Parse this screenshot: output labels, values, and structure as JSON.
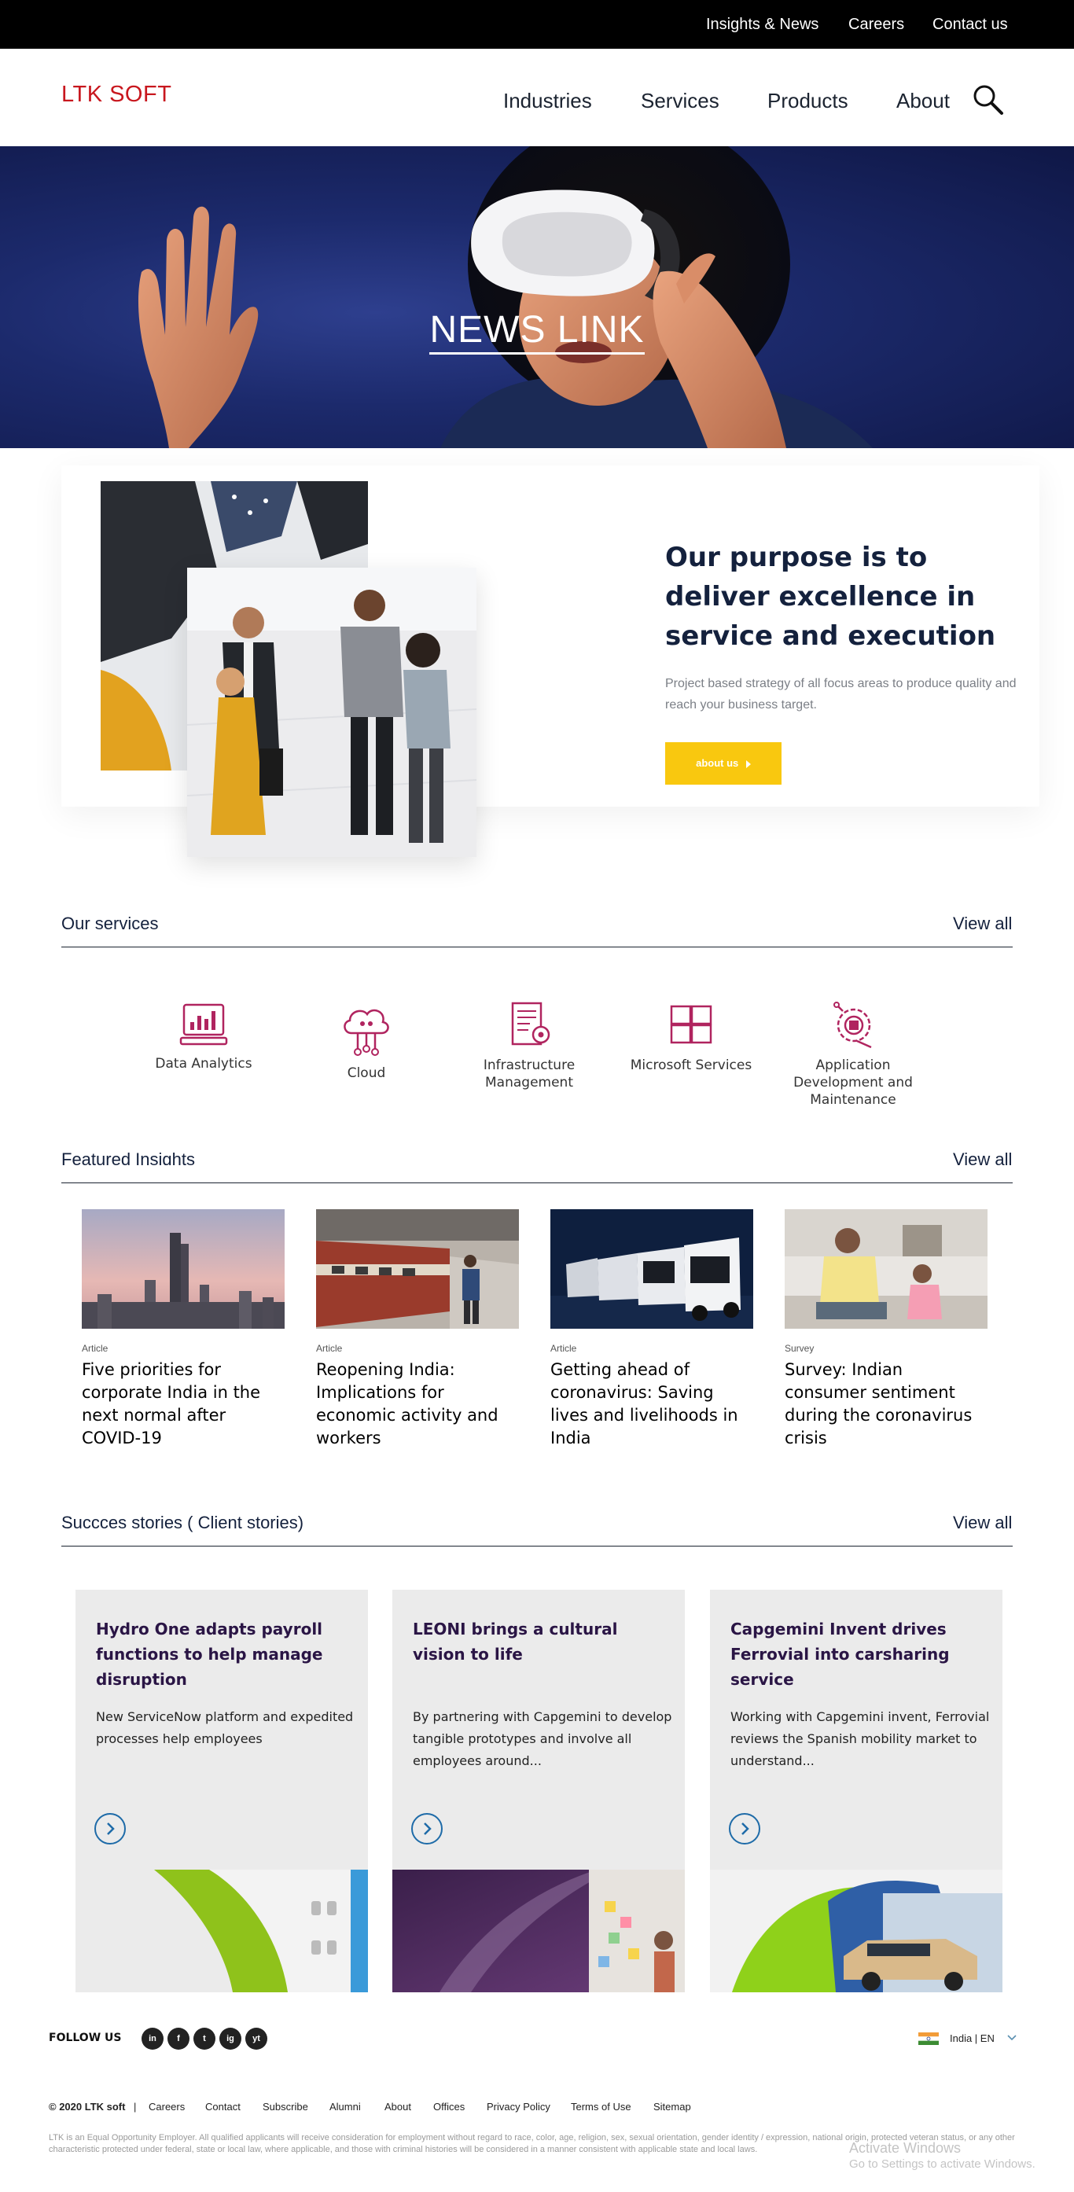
{
  "topbar": {
    "links": [
      "Insights & News",
      "Careers",
      "Contact us"
    ]
  },
  "header": {
    "logo": "LTK SOFT",
    "nav": [
      "Industries",
      "Services",
      "Products",
      "About"
    ]
  },
  "hero": {
    "title": "NEWS LINK"
  },
  "purpose": {
    "heading": "Our purpose is to deliver excellence in service and execution",
    "text": "Project based strategy of all focus areas to produce quality and reach your business target.",
    "button": "about us"
  },
  "services": {
    "title": "Our services",
    "view_all": "View all",
    "items": [
      {
        "label": "Data Analytics",
        "icon": "data-analytics-icon"
      },
      {
        "label": "Cloud",
        "icon": "cloud-icon"
      },
      {
        "label": "Infrastructure Management",
        "icon": "infrastructure-icon"
      },
      {
        "label": "Microsoft Services",
        "icon": "microsoft-icon"
      },
      {
        "label": "Application Development and Maintenance",
        "icon": "app-development-icon"
      }
    ],
    "icon_color": "#b0245f"
  },
  "insights": {
    "title": "Featured Insights",
    "view_all": "View all",
    "items": [
      {
        "type": "Article",
        "title": "Five priorities for corporate India in the next normal after COVID-19"
      },
      {
        "type": "Article",
        "title": "Reopening India: Implications for economic activity and workers"
      },
      {
        "type": "Article",
        "title": "Getting ahead of coronavirus: Saving lives and livelihoods in India"
      },
      {
        "type": "Survey",
        "title": "Survey: Indian consumer sentiment during the coronavirus crisis"
      }
    ]
  },
  "stories": {
    "title": "Succces stories ( Client stories)",
    "view_all": "View all",
    "items": [
      {
        "title": "Hydro One adapts payroll functions to help manage disruption",
        "text": "New ServiceNow platform and expedited processes help employees"
      },
      {
        "title": "LEONI brings a cultural vision to life",
        "text": "By partnering with Capgemini to develop tangible prototypes and involve all employees around..."
      },
      {
        "title": "Capgemini Invent drives Ferrovial into carsharing service",
        "text": "Working with Capgemini invent, Ferrovial reviews the Spanish mobility market to understand..."
      }
    ]
  },
  "footer": {
    "follow": "FOLLOW US",
    "social": [
      "in",
      "f",
      "t",
      "ig",
      "yt"
    ],
    "locale": "India | EN",
    "copyright": "© 2020 LTK soft",
    "separator": "|",
    "links": [
      "Careers",
      "Contact",
      "Subscribe",
      "Alumni",
      "About",
      "Offices",
      "Privacy Policy",
      "Terms of Use",
      "Sitemap"
    ],
    "legal": "LTK is an Equal Opportunity Employer. All qualified applicants will receive consideration for employment without regard to race, color, age, religion, sex, sexual orientation, gender identity / expression, national origin, protected veteran status, or any other characteristic protected under federal, state or local law, where applicable, and those with criminal histories will be considered in a manner consistent with applicable state and local laws.",
    "watermark_title": "Activate Windows",
    "watermark_text": "Go to Settings to activate Windows."
  }
}
